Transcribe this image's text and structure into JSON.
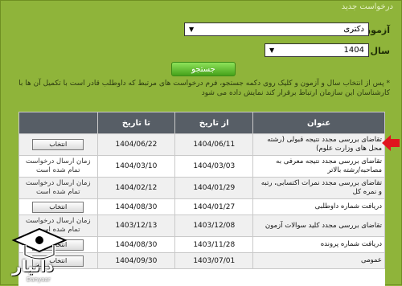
{
  "section_title": "درخواست جدید",
  "form": {
    "exam_label": "آزمون",
    "exam_value": "دکتری",
    "year_label": "سال",
    "year_value": "1404",
    "search_label": "جستجو"
  },
  "note": "* پس از انتخاب سال و آزمون و کلیک روی دکمه جستجو، فرم درخواست های مرتبط که داوطلب قادر است با تکمیل آن ها با کارشناسان این سازمان ارتباط برقرار کند نمایش داده می شود",
  "table": {
    "headers": [
      "عنوان",
      "از تاریخ",
      "تا تاریخ",
      ""
    ],
    "select_label": "انتخاب",
    "rows": [
      {
        "title": "تقاضای بررسی مجدد نتیجه قبولی (رشته محل های وزارت علوم)",
        "from": "1404/06/11",
        "to": "1404/06/22",
        "action": "انتخاب",
        "button": true
      },
      {
        "title": "تقاضای بررسی مجدد نتیجه معرفی به مصاحبه/رشته بالاتر",
        "from": "1404/03/03",
        "to": "1404/03/10",
        "action": "زمان ارسال درخواست تمام شده است",
        "button": false
      },
      {
        "title": "تقاضای بررسی مجدد نمرات اکتسابی، رتبه و نمره کل",
        "from": "1404/01/29",
        "to": "1404/02/12",
        "action": "زمان ارسال درخواست تمام شده است",
        "button": false
      },
      {
        "title": "دریافت شماره داوطلبی",
        "from": "1404/01/27",
        "to": "1404/08/30",
        "action": "انتخاب",
        "button": true
      },
      {
        "title": "تقاضای بررسی مجدد کلید سوالات آزمون",
        "from": "1403/12/08",
        "to": "1403/12/13",
        "action": "زمان ارسال درخواست تمام شده است",
        "button": false
      },
      {
        "title": "دریافت شماره پرونده",
        "from": "1403/11/28",
        "to": "1404/08/30",
        "action": "انتخاب",
        "button": true
      },
      {
        "title": "عمومی",
        "from": "1403/07/01",
        "to": "1404/09/30",
        "action": "انتخاب",
        "button": true
      }
    ]
  },
  "watermark": {
    "brand": "دانیار",
    "sub": "Danyaar"
  },
  "colors": {
    "page_bg": "#8fb43a",
    "header_bg": "#575e66",
    "button_green": "#46a21a",
    "arrow_red": "#e0141e"
  }
}
